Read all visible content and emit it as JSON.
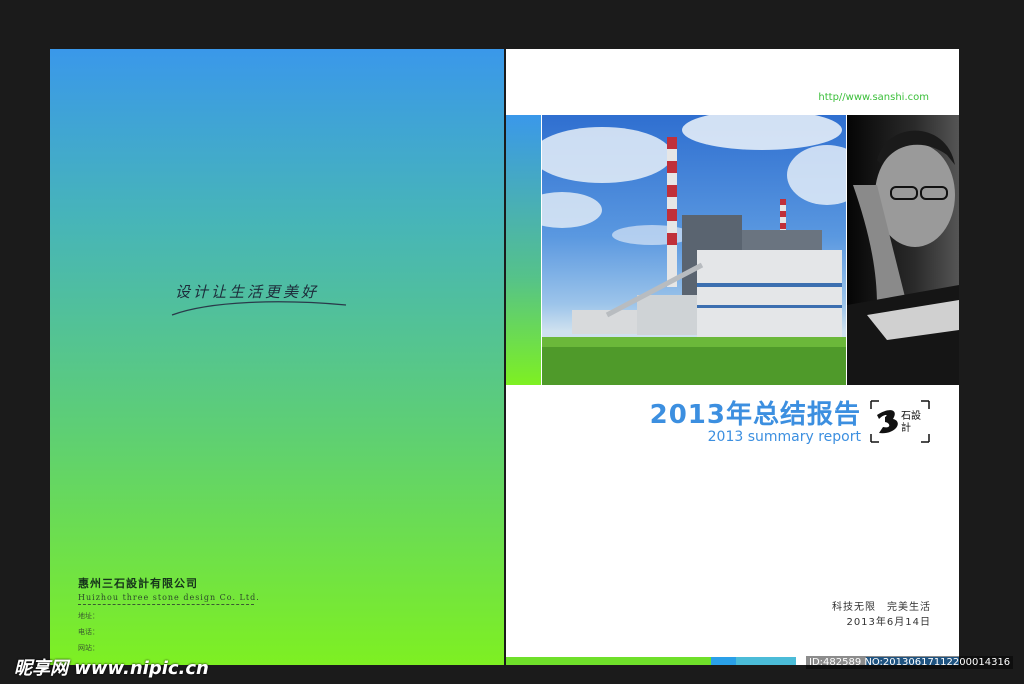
{
  "left": {
    "slogan": "设计让生活更美好",
    "company_cn": "惠州三石設計有限公司",
    "company_en": "Huizhou three stone design Co. Ltd.",
    "address_label": "地址：",
    "phone_label": "电话：",
    "web_label": "网站："
  },
  "right": {
    "url": "http//www.sanshi.com",
    "title": "2013年总结报告",
    "subtitle": "2013 summary report",
    "logo_text": "石設計",
    "tagline": "科技无限　完美生活",
    "date": "2013年6月14日"
  },
  "watermark": {
    "site": "昵享网 www.nipic.cn",
    "id": "ID:482589 NO:20130617112200014316"
  },
  "colors": {
    "gradient_top": "#3a98ea",
    "gradient_bottom": "#7ef022",
    "title_blue": "#3c8fe0",
    "url_green": "#3bbf3a"
  }
}
